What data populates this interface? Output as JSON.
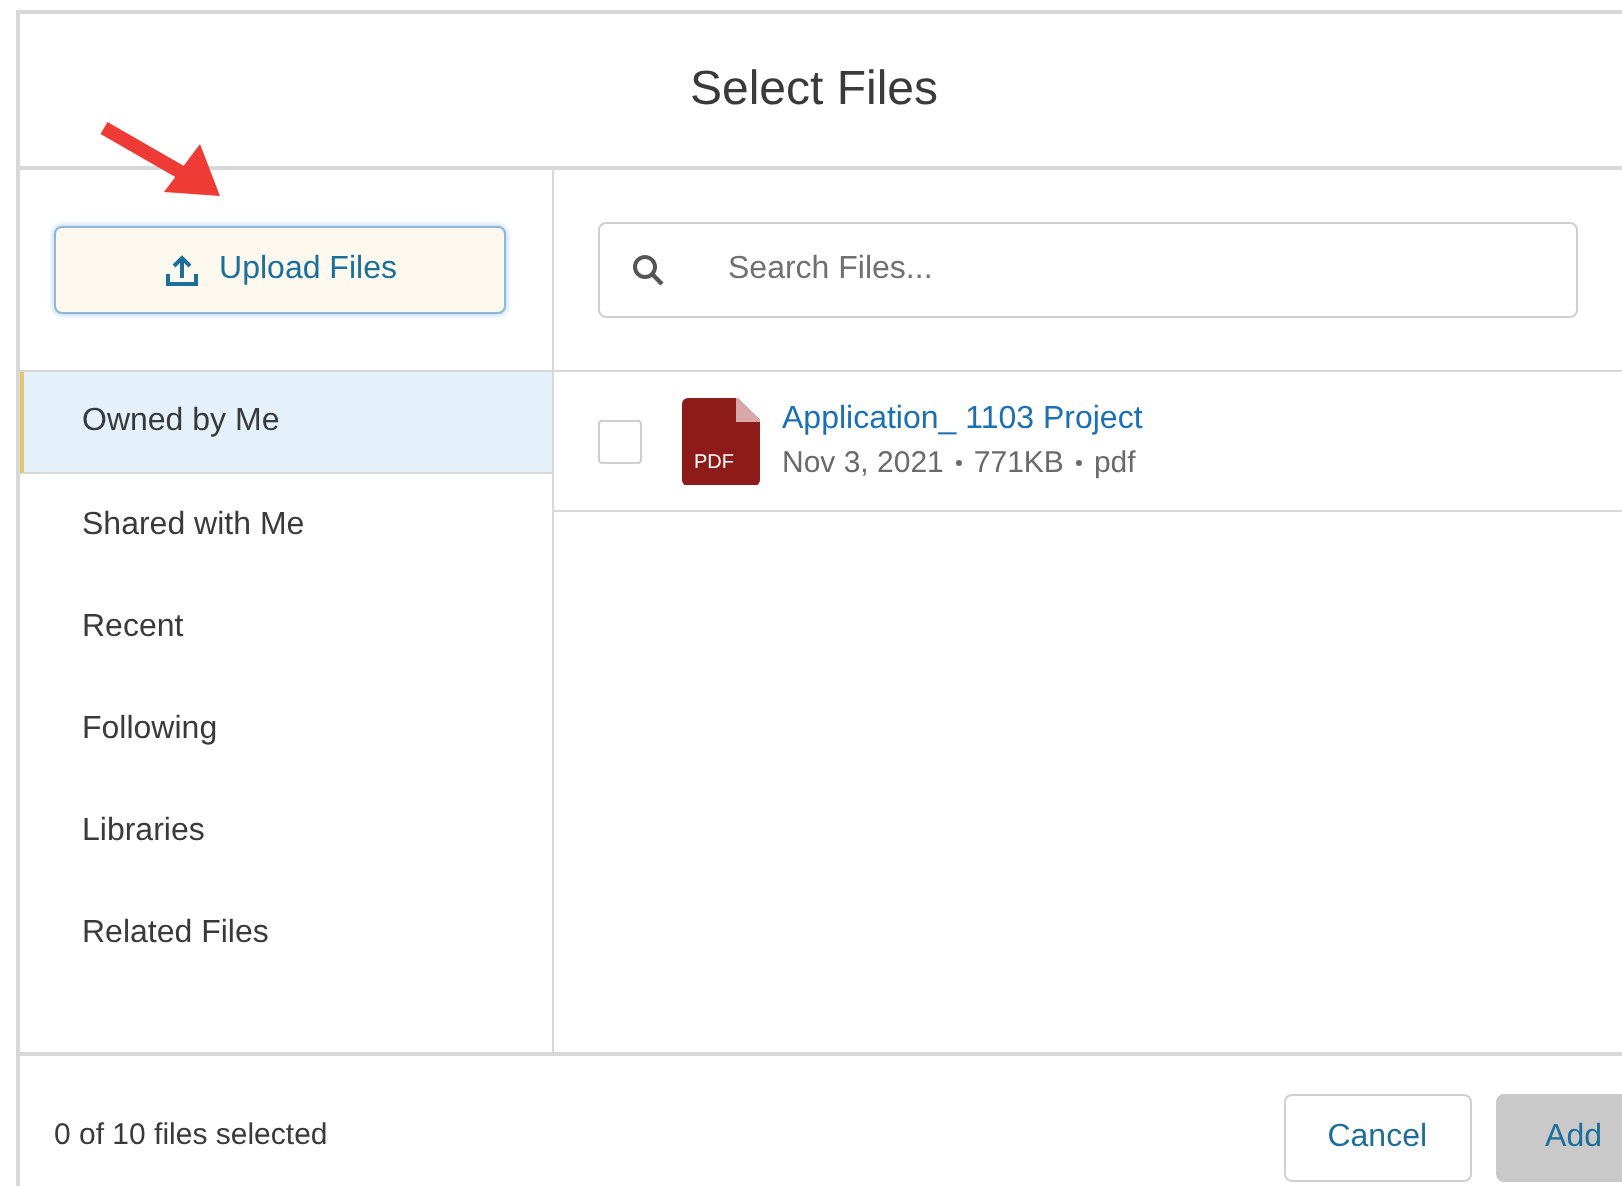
{
  "dialog": {
    "title": "Select Files"
  },
  "upload_button": {
    "label": "Upload Files"
  },
  "sidebar": {
    "items": [
      {
        "label": "Owned by Me",
        "selected": true
      },
      {
        "label": "Shared with Me",
        "selected": false
      },
      {
        "label": "Recent",
        "selected": false
      },
      {
        "label": "Following",
        "selected": false
      },
      {
        "label": "Libraries",
        "selected": false
      },
      {
        "label": "Related Files",
        "selected": false
      }
    ]
  },
  "search": {
    "placeholder": "Search Files..."
  },
  "files": [
    {
      "name": "Application_ 1103 Project",
      "type_badge": "PDF",
      "date": "Nov 3, 2021",
      "size": "771KB",
      "extension": "pdf",
      "checked": false
    }
  ],
  "footer": {
    "selection_count": "0 of 10 files selected",
    "buttons": [
      {
        "label": "Cancel",
        "disabled": false
      },
      {
        "label": "Add",
        "disabled": true
      }
    ]
  }
}
